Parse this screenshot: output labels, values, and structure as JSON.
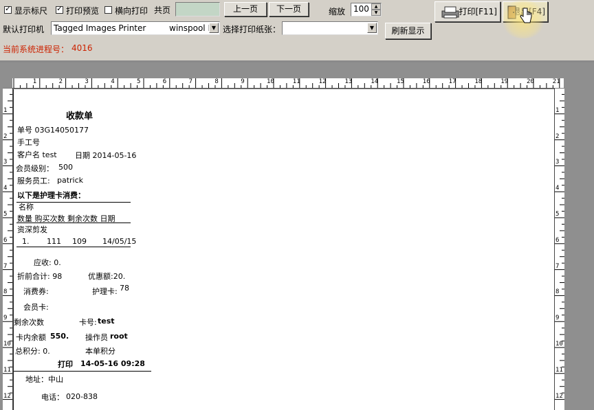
{
  "toolbar": {
    "show_ruler_label": "显示标尺",
    "print_preview_label": "打印预览",
    "landscape_label": "横向打印",
    "total_pages_label": "共页",
    "prev_page_label": "上一页",
    "next_page_label": "下一页",
    "zoom_label": "缩放",
    "zoom_value": "100",
    "print_button": "打印[F11]",
    "exit_button": "退出[F4]",
    "default_printer_label": "默认打印机",
    "printer_name": "Tagged Images Printer",
    "printer_port": "winspool  I",
    "paper_label": "选择打印纸张：",
    "paper_value": "",
    "refresh_button": "刷新显示",
    "process_label": "当前系统进程号：",
    "process_id": "4016"
  },
  "ruler": {
    "h_numbers": [
      "1",
      "2",
      "3",
      "4",
      "5",
      "6",
      "7",
      "8",
      "9",
      "10",
      "11",
      "12",
      "13",
      "14",
      "15",
      "16",
      "17",
      "18",
      "19",
      "20",
      "21"
    ],
    "v_numbers": [
      "1",
      "2",
      "3",
      "4",
      "5",
      "6",
      "7",
      "8",
      "9",
      "10",
      "11",
      "12"
    ]
  },
  "receipt": {
    "title": "收款单",
    "order_no": "单号 03G14050177",
    "manual_no": "手工号",
    "customer": "客户名 test",
    "date": "日期 2014-05-16",
    "member_level_label": "会员级别：",
    "member_level": "500",
    "staff_label": "服务员工:",
    "staff": "patrick",
    "section_title": "以下是护理卡消费：",
    "col_name": "名称",
    "col_headers": "数量  购买次数  剩余次数  日期",
    "item_name": "资深剪发",
    "item_row": {
      "qty": "1.",
      "bought": "111",
      "remaining": "109",
      "date": "14/05/15"
    },
    "receivable": "应收: 0.",
    "pre_discount": "折前合计: 98",
    "discount": "优惠额:20.",
    "coupon": "消费券:",
    "care_card": "护理卡:",
    "care_card_value": "78",
    "member_card": "会员卡:",
    "remaining_times": "剩余次数",
    "card_no_label": "卡号:",
    "card_no": "test",
    "card_balance_label": "卡内余额",
    "card_balance": "550.",
    "operator_label": "操作员",
    "operator": "root",
    "total_points": "总积分:  0.",
    "order_points": "本单积分",
    "print_label": "打印",
    "print_time": "14-05-16 09:28",
    "address": "地址：中山",
    "phone_label": "电话：",
    "phone": "020-838"
  }
}
